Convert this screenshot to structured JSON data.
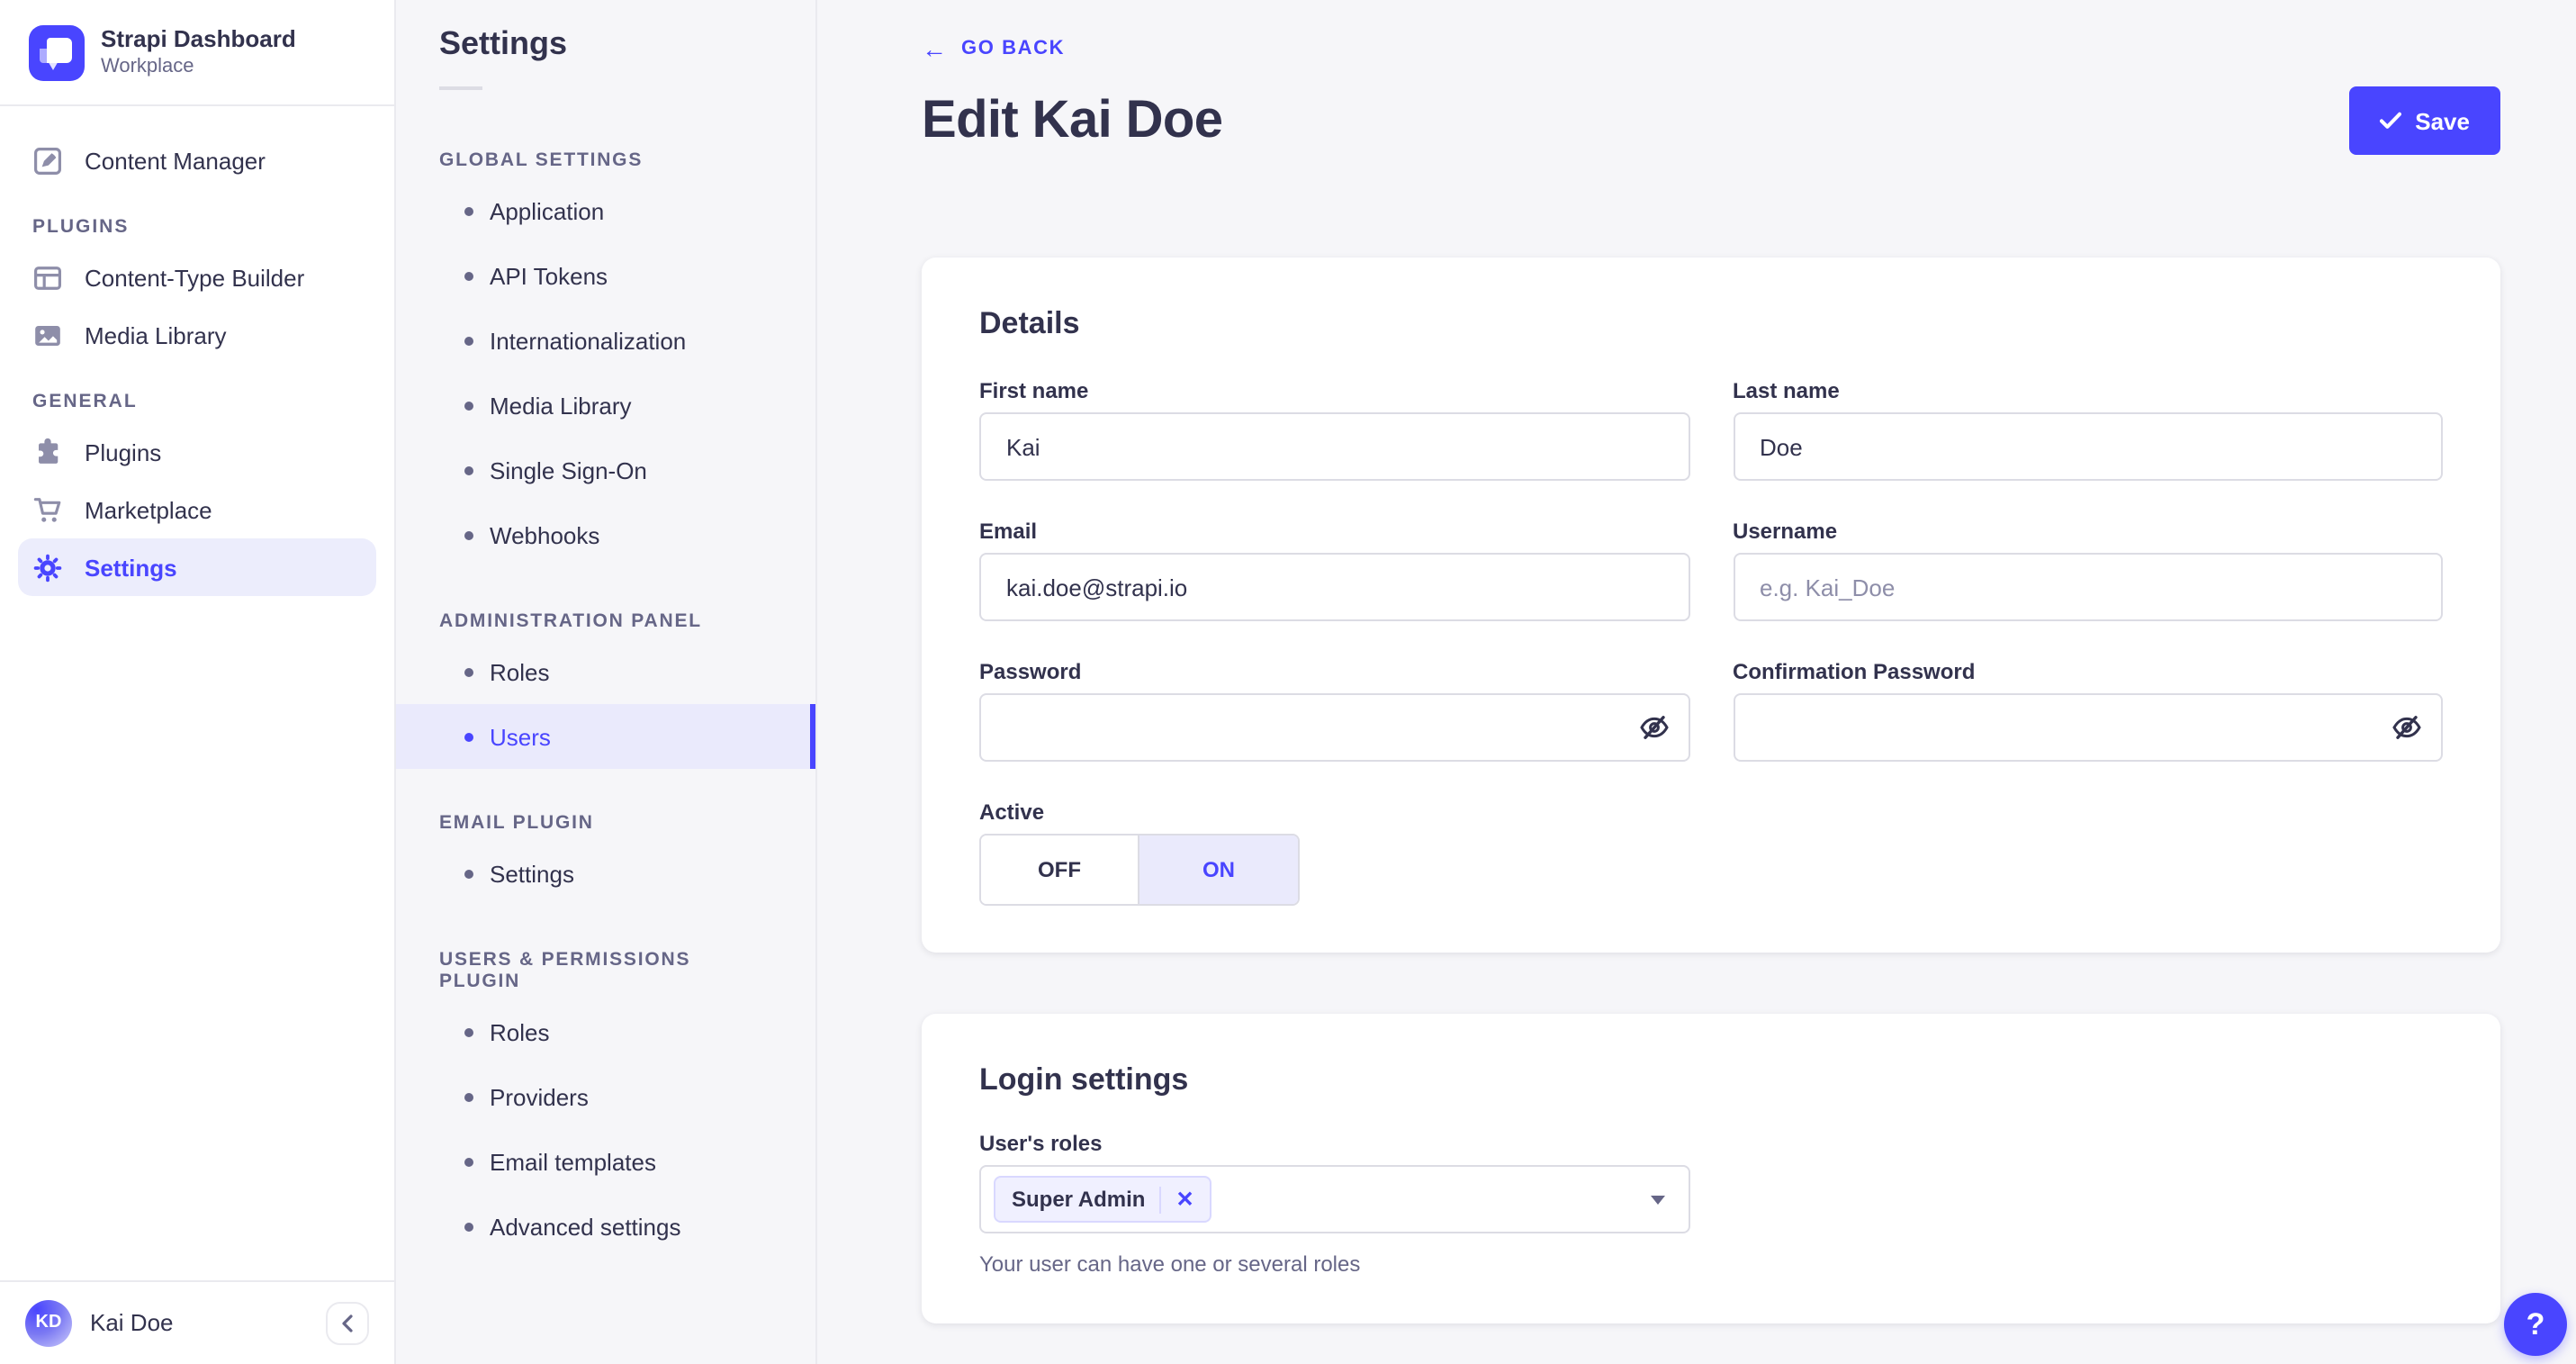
{
  "colors": {
    "primary": "#4945ff",
    "primary_light_bg": "#eaeafc",
    "chip_bg": "#f0f0ff",
    "chip_border": "#d9d8ff",
    "text_dark": "#32324d",
    "text_gray": "#666687",
    "icon_gray": "#8e8ea9",
    "border": "#dcdce4",
    "panel_border": "#eaeaef",
    "page_bg": "#f6f6f9"
  },
  "sidebar": {
    "brand": {
      "title": "Strapi Dashboard",
      "subtitle": "Workplace"
    },
    "top_item": {
      "label": "Content Manager",
      "icon": "content-manager-icon"
    },
    "sections": [
      {
        "label": "PLUGINS",
        "items": [
          {
            "label": "Content-Type Builder",
            "icon": "content-type-builder-icon"
          },
          {
            "label": "Media Library",
            "icon": "media-library-icon"
          }
        ]
      },
      {
        "label": "GENERAL",
        "items": [
          {
            "label": "Plugins",
            "icon": "plugins-icon"
          },
          {
            "label": "Marketplace",
            "icon": "marketplace-icon"
          },
          {
            "label": "Settings",
            "icon": "settings-icon",
            "active": true
          }
        ]
      }
    ],
    "footer": {
      "user_name": "Kai Doe",
      "user_initials": "KD",
      "collapse_icon": "chevron-left-icon"
    }
  },
  "settings_nav": {
    "title": "Settings",
    "sections": [
      {
        "label": "GLOBAL SETTINGS",
        "items": [
          {
            "label": "Application"
          },
          {
            "label": "API Tokens"
          },
          {
            "label": "Internationalization"
          },
          {
            "label": "Media Library"
          },
          {
            "label": "Single Sign-On"
          },
          {
            "label": "Webhooks"
          }
        ]
      },
      {
        "label": "ADMINISTRATION PANEL",
        "items": [
          {
            "label": "Roles"
          },
          {
            "label": "Users",
            "active": true
          }
        ]
      },
      {
        "label": "EMAIL PLUGIN",
        "items": [
          {
            "label": "Settings"
          }
        ]
      },
      {
        "label": "USERS & PERMISSIONS PLUGIN",
        "items": [
          {
            "label": "Roles"
          },
          {
            "label": "Providers"
          },
          {
            "label": "Email templates"
          },
          {
            "label": "Advanced settings"
          }
        ]
      }
    ]
  },
  "header": {
    "back_label": "GO BACK",
    "back_arrow": "←",
    "title": "Edit Kai Doe",
    "save_label": "Save"
  },
  "details_card": {
    "title": "Details",
    "fields": [
      {
        "label": "First name",
        "value": "Kai",
        "placeholder": "",
        "type": "text"
      },
      {
        "label": "Last name",
        "value": "Doe",
        "placeholder": "",
        "type": "text"
      },
      {
        "label": "Email",
        "value": "kai.doe@strapi.io",
        "placeholder": "",
        "type": "text"
      },
      {
        "label": "Username",
        "value": "",
        "placeholder": "e.g. Kai_Doe",
        "type": "text"
      },
      {
        "label": "Password",
        "value": "",
        "placeholder": "",
        "type": "password"
      },
      {
        "label": "Confirmation Password",
        "value": "",
        "placeholder": "",
        "type": "password"
      }
    ],
    "active_toggle": {
      "label": "Active",
      "off_label": "OFF",
      "on_label": "ON",
      "value": "ON"
    }
  },
  "login_card": {
    "title": "Login settings",
    "roles_label": "User's roles",
    "selected_roles": [
      {
        "label": "Super Admin",
        "remove": "✕"
      }
    ],
    "helper": "Your user can have one or several roles"
  },
  "help": {
    "label": "?"
  }
}
